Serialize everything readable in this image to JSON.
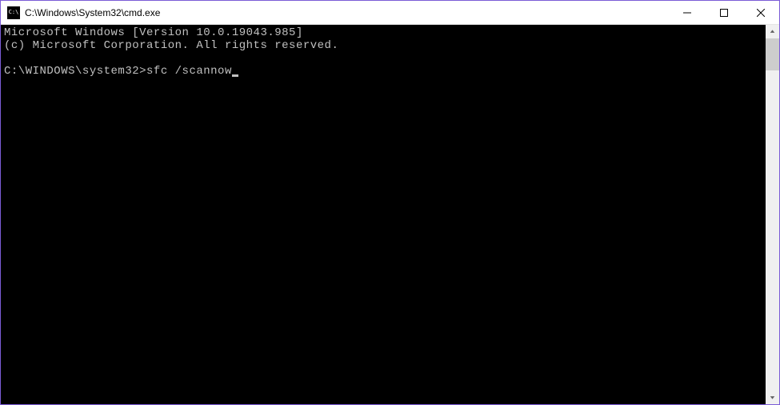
{
  "window": {
    "title": "C:\\Windows\\System32\\cmd.exe",
    "icon_label": "C:\\"
  },
  "terminal": {
    "line1": "Microsoft Windows [Version 10.0.19043.985]",
    "line2": "(c) Microsoft Corporation. All rights reserved.",
    "prompt": "C:\\WINDOWS\\system32>",
    "command": "sfc /scannow"
  }
}
